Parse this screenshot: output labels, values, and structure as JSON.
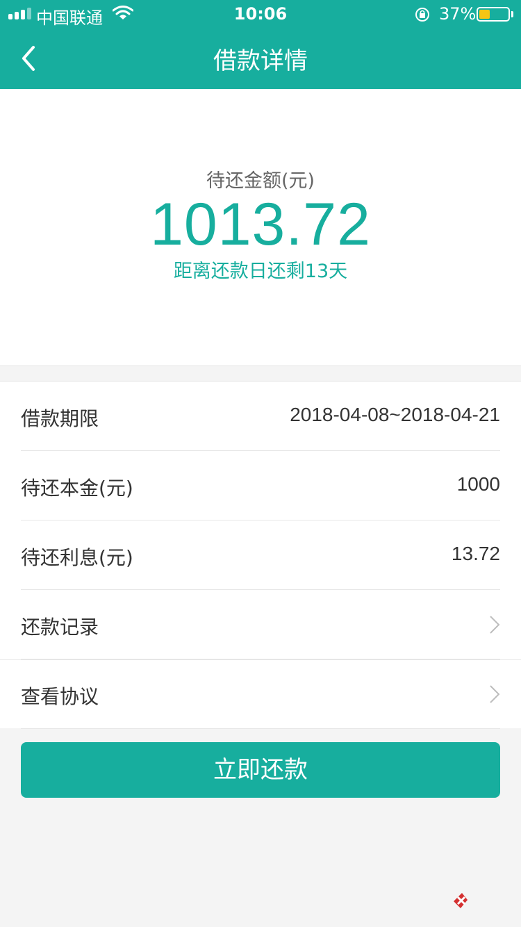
{
  "status_bar": {
    "carrier": "中国联通",
    "time": "10:06",
    "battery_percent": "37%",
    "battery_level": 0.37,
    "signal_bars_filled": 3
  },
  "nav": {
    "title": "借款详情",
    "back_icon": "chevron-left-icon"
  },
  "summary": {
    "label": "待还金额(元)",
    "amount": "1013.72",
    "countdown": "距离还款日还剩13天"
  },
  "details": [
    {
      "label": "借款期限",
      "value": "2018-04-08~2018-04-21"
    },
    {
      "label": "待还本金(元)",
      "value": "1000"
    },
    {
      "label": "待还利息(元)",
      "value": "13.72"
    },
    {
      "label": "还款记录",
      "icon": "chevron-right-icon"
    },
    {
      "label": "查看协议",
      "icon": "chevron-right-icon"
    }
  ],
  "action": {
    "pay_label": "立即还款"
  },
  "colors": {
    "brand": "#17ae9e",
    "battery": "#f6c514"
  }
}
